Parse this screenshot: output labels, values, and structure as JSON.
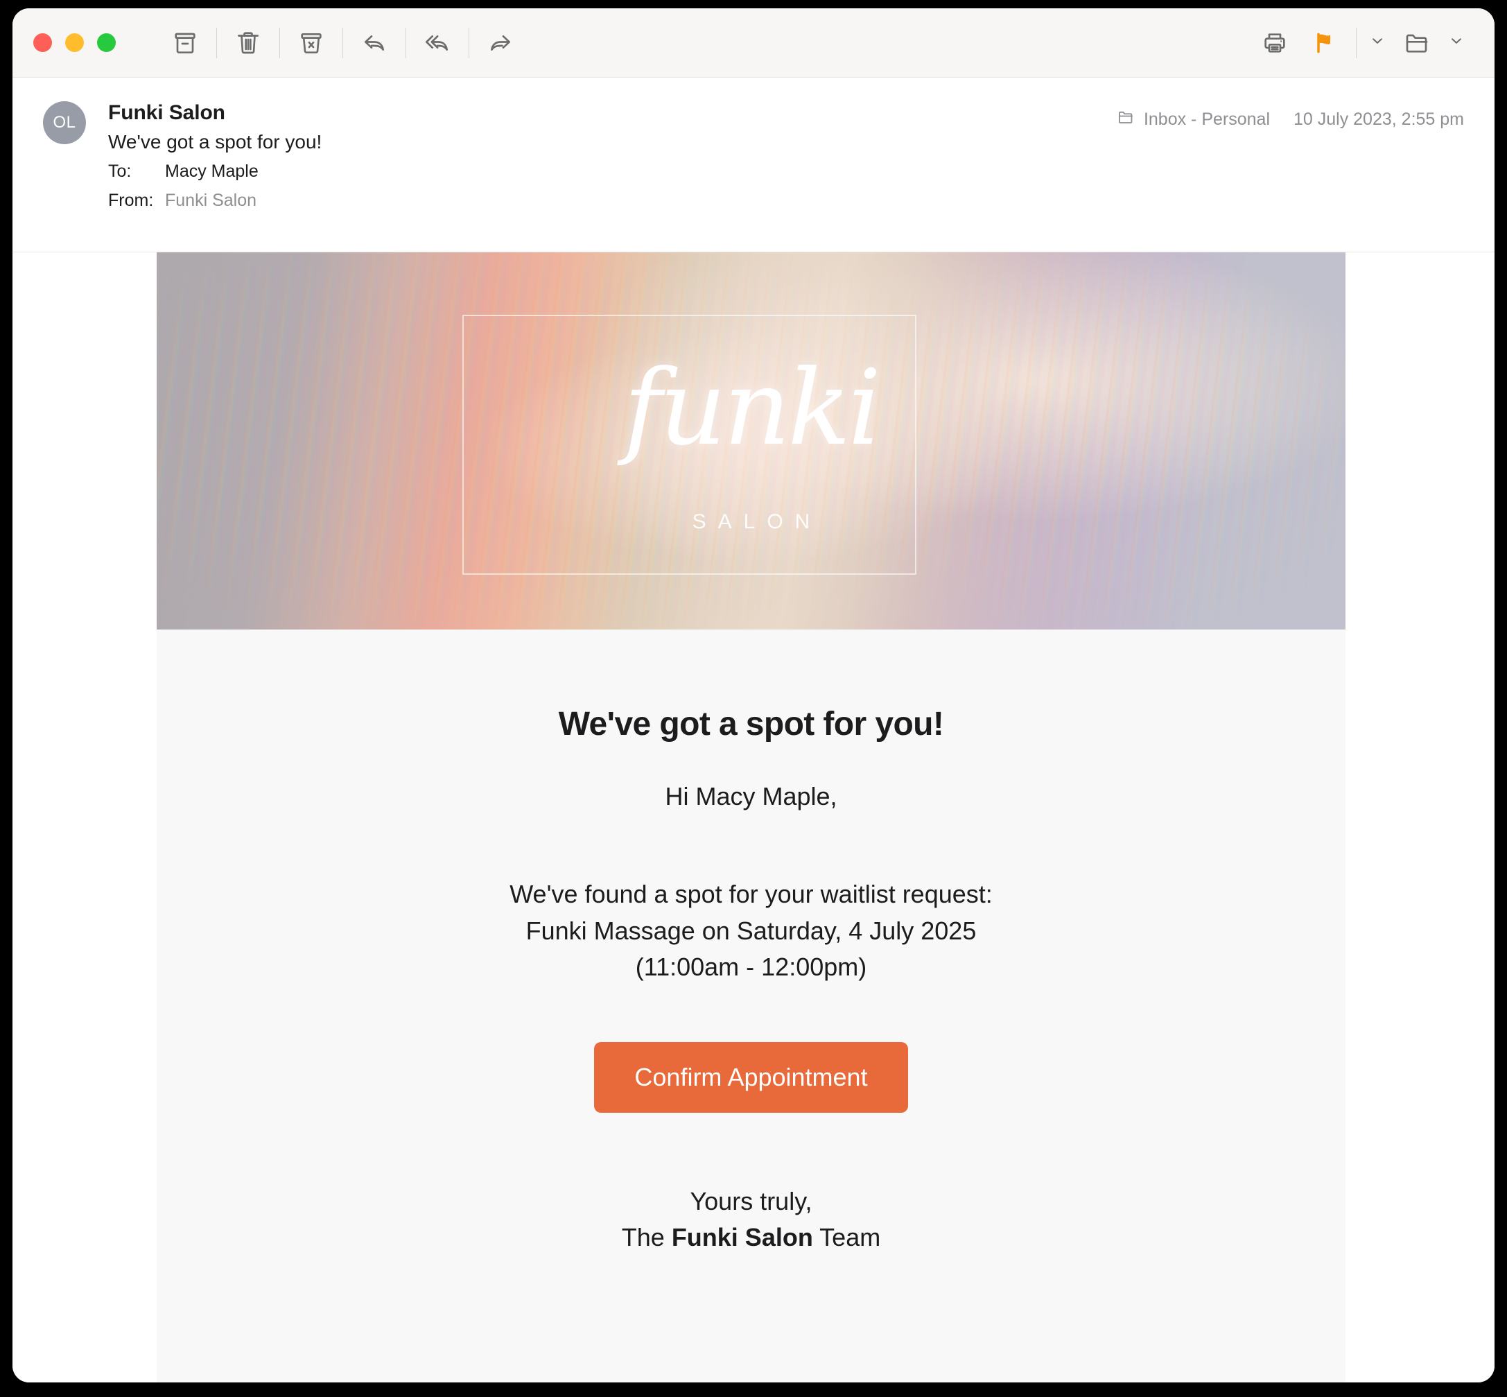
{
  "window": {
    "traffic_lights": [
      {
        "name": "close",
        "color": "#ff5f56"
      },
      {
        "name": "minimize",
        "color": "#ffbd2e"
      },
      {
        "name": "maximize",
        "color": "#27c93f"
      }
    ]
  },
  "toolbar": {
    "archive_label": "Archive",
    "delete_label": "Delete",
    "junk_label": "Move to Junk",
    "reply_label": "Reply",
    "reply_all_label": "Reply All",
    "forward_label": "Forward",
    "print_label": "Print",
    "flag_label": "Flag",
    "flag_color": "#f5930a",
    "flag_menu_label": "Flag options",
    "move_label": "Move to folder",
    "move_menu_label": "Move options"
  },
  "message": {
    "avatar_initials": "OL",
    "sender": "Funki Salon",
    "subject": "We've got a spot for you!",
    "to_label": "To:",
    "to_value": "Macy Maple",
    "from_label": "From:",
    "from_value": "Funki Salon",
    "mailbox": "Inbox - Personal",
    "date": "10 July 2023, 2:55 pm"
  },
  "email": {
    "banner": {
      "logo": "funki",
      "tagline": "SALON"
    },
    "title": "We've got a spot for you!",
    "greeting": "Hi Macy Maple,",
    "body_line1": "We've found a spot for your waitlist request:",
    "body_line2": "Funki Massage on Saturday, 4 July 2025",
    "body_line3": "(11:00am - 12:00pm)",
    "cta_label": "Confirm Appointment",
    "cta_color": "#e8693a",
    "signoff_line1": "Yours truly,",
    "signoff_prefix": "The ",
    "signoff_brand": "Funki Salon",
    "signoff_suffix": " Team"
  }
}
